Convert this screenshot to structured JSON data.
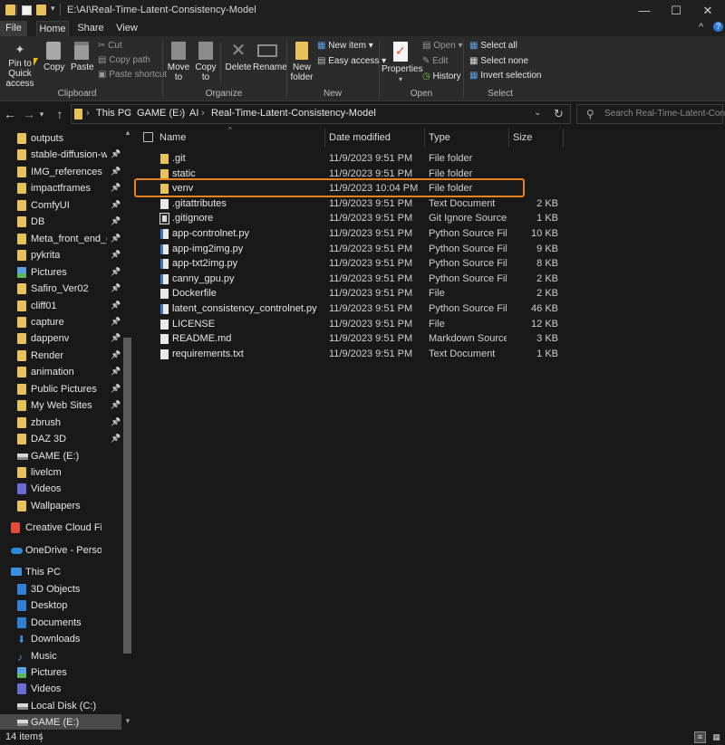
{
  "window": {
    "title": "E:\\AI\\Real-Time-Latent-Consistency-Model",
    "minimize": "—",
    "maximize": "☐",
    "close": "✕",
    "help": "?",
    "collapse": "^"
  },
  "ribbon_tabs": [
    "File",
    "Home",
    "Share",
    "View"
  ],
  "ribbon": {
    "clipboard": {
      "label": "Clipboard",
      "pin_line1": "Pin to Quick",
      "pin_line2": "access",
      "copy": "Copy",
      "paste": "Paste",
      "cut": "Cut",
      "copy_path": "Copy path",
      "paste_shortcut": "Paste shortcut"
    },
    "organize": {
      "label": "Organize",
      "move_line1": "Move",
      "move_line2": "to",
      "copy_line1": "Copy",
      "copy_line2": "to",
      "delete": "Delete",
      "rename": "Rename"
    },
    "new": {
      "label": "New",
      "new_folder_line1": "New",
      "new_folder_line2": "folder",
      "new_item": "New item",
      "easy_access": "Easy access"
    },
    "open": {
      "label": "Open",
      "properties": "Properties",
      "open": "Open",
      "edit": "Edit",
      "history": "History"
    },
    "select": {
      "label": "Select",
      "select_all": "Select all",
      "select_none": "Select none",
      "invert_selection": "Invert selection"
    }
  },
  "address": {
    "crumbs": [
      "This PC",
      "GAME (E:)",
      "AI",
      "Real-Time-Latent-Consistency-Model"
    ],
    "search_placeholder": "Search Real-Time-Latent-Con..."
  },
  "nav_pane": {
    "quick_access": [
      {
        "label": "outputs",
        "icon": "folder",
        "pinned": false
      },
      {
        "label": "stable-diffusion-webu",
        "icon": "folder",
        "pinned": true
      },
      {
        "label": "IMG_references",
        "icon": "folder",
        "pinned": true
      },
      {
        "label": "impactframes",
        "icon": "folder",
        "pinned": true
      },
      {
        "label": "ComfyUI",
        "icon": "folder",
        "pinned": true
      },
      {
        "label": "DB",
        "icon": "folder",
        "pinned": true
      },
      {
        "label": "Meta_front_end_dev",
        "icon": "folder",
        "pinned": true
      },
      {
        "label": "pykrita",
        "icon": "folder",
        "pinned": true
      },
      {
        "label": "Pictures",
        "icon": "pictures",
        "pinned": true
      },
      {
        "label": "Safiro_Ver02",
        "icon": "folder",
        "pinned": true
      },
      {
        "label": "cliff01",
        "icon": "folder",
        "pinned": true
      },
      {
        "label": "capture",
        "icon": "folder",
        "pinned": true
      },
      {
        "label": "dappenv",
        "icon": "folder",
        "pinned": true
      },
      {
        "label": "Render",
        "icon": "folder",
        "pinned": true
      },
      {
        "label": "animation",
        "icon": "folder",
        "pinned": true
      },
      {
        "label": "Public Pictures",
        "icon": "folder",
        "pinned": true
      },
      {
        "label": "My Web Sites",
        "icon": "folder",
        "pinned": true
      },
      {
        "label": "zbrush",
        "icon": "folder",
        "pinned": true
      },
      {
        "label": "DAZ 3D",
        "icon": "folder",
        "pinned": true
      },
      {
        "label": "GAME (E:)",
        "icon": "drive",
        "pinned": false
      },
      {
        "label": "livelcm",
        "icon": "folder",
        "pinned": false
      },
      {
        "label": "Videos",
        "icon": "videos",
        "pinned": false
      },
      {
        "label": "Wallpapers",
        "icon": "folder",
        "pinned": false
      }
    ],
    "creative_cloud": "Creative Cloud Files",
    "onedrive": "OneDrive - Personal",
    "this_pc": "This PC",
    "this_pc_items": [
      {
        "label": "3D Objects",
        "icon": "blue"
      },
      {
        "label": "Desktop",
        "icon": "blue"
      },
      {
        "label": "Documents",
        "icon": "doc"
      },
      {
        "label": "Downloads",
        "icon": "download"
      },
      {
        "label": "Music",
        "icon": "music"
      },
      {
        "label": "Pictures",
        "icon": "pictures"
      },
      {
        "label": "Videos",
        "icon": "videos"
      },
      {
        "label": "Local Disk (C:)",
        "icon": "drive"
      },
      {
        "label": "GAME (E:)",
        "icon": "drive"
      }
    ]
  },
  "columns": {
    "name": "Name",
    "date": "Date modified",
    "type": "Type",
    "size": "Size"
  },
  "files": [
    {
      "name": ".git",
      "date": "11/9/2023 9:51 PM",
      "type": "File folder",
      "size": "",
      "icon": "folder"
    },
    {
      "name": "static",
      "date": "11/9/2023 9:51 PM",
      "type": "File folder",
      "size": "",
      "icon": "folder"
    },
    {
      "name": "venv",
      "date": "11/9/2023 10:04 PM",
      "type": "File folder",
      "size": "",
      "icon": "folder"
    },
    {
      "name": ".gitattributes",
      "date": "11/9/2023 9:51 PM",
      "type": "Text Document",
      "size": "2 KB",
      "icon": "doc"
    },
    {
      "name": ".gitignore",
      "date": "11/9/2023 9:51 PM",
      "type": "Git Ignore Source ...",
      "size": "1 KB",
      "icon": "git"
    },
    {
      "name": "app-controlnet.py",
      "date": "11/9/2023 9:51 PM",
      "type": "Python Source File",
      "size": "10 KB",
      "icon": "py"
    },
    {
      "name": "app-img2img.py",
      "date": "11/9/2023 9:51 PM",
      "type": "Python Source File",
      "size": "9 KB",
      "icon": "py"
    },
    {
      "name": "app-txt2img.py",
      "date": "11/9/2023 9:51 PM",
      "type": "Python Source File",
      "size": "8 KB",
      "icon": "py"
    },
    {
      "name": "canny_gpu.py",
      "date": "11/9/2023 9:51 PM",
      "type": "Python Source File",
      "size": "2 KB",
      "icon": "py"
    },
    {
      "name": "Dockerfile",
      "date": "11/9/2023 9:51 PM",
      "type": "File",
      "size": "2 KB",
      "icon": "doc"
    },
    {
      "name": "latent_consistency_controlnet.py",
      "date": "11/9/2023 9:51 PM",
      "type": "Python Source File",
      "size": "46 KB",
      "icon": "py"
    },
    {
      "name": "LICENSE",
      "date": "11/9/2023 9:51 PM",
      "type": "File",
      "size": "12 KB",
      "icon": "doc"
    },
    {
      "name": "README.md",
      "date": "11/9/2023 9:51 PM",
      "type": "Markdown Source ...",
      "size": "3 KB",
      "icon": "doc"
    },
    {
      "name": "requirements.txt",
      "date": "11/9/2023 9:51 PM",
      "type": "Text Document",
      "size": "1 KB",
      "icon": "doc"
    }
  ],
  "status": {
    "item_count": "14 items"
  },
  "colors": {
    "accent_highlight": "#e7821e",
    "folder": "#e8c15a",
    "background": "#191919"
  }
}
